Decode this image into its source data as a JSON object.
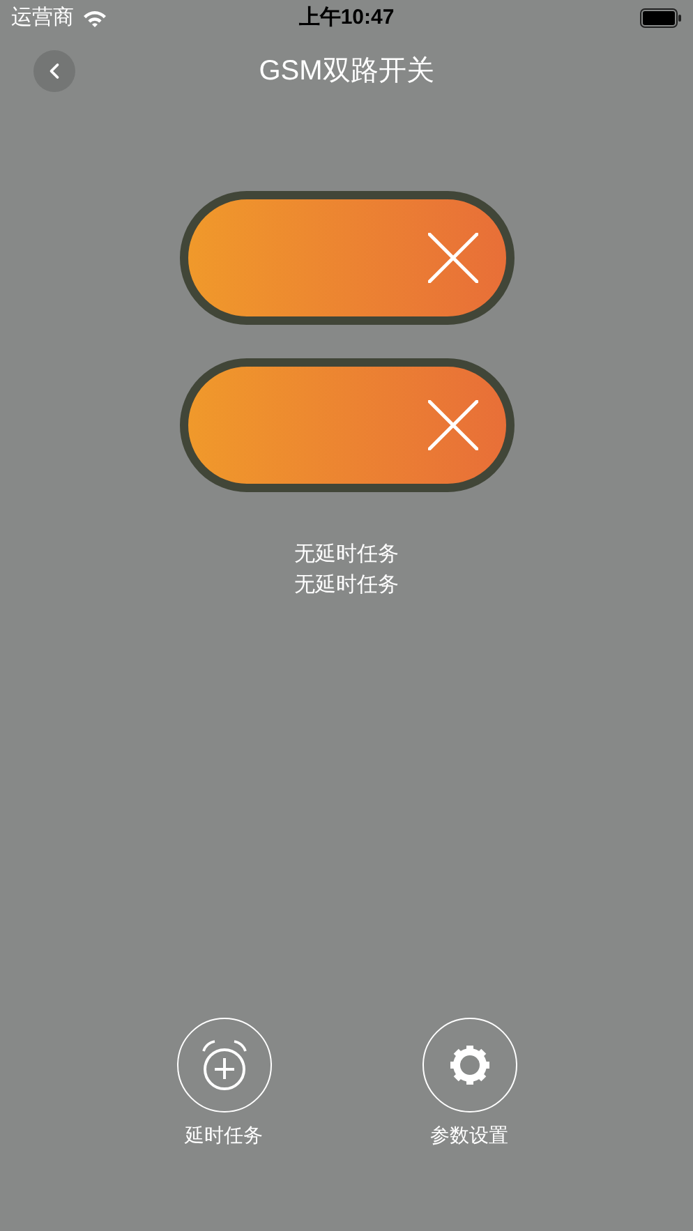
{
  "status_bar": {
    "carrier": "运营商",
    "time": "上午10:47"
  },
  "nav": {
    "title": "GSM双路开关"
  },
  "switches": [
    {
      "on": false
    },
    {
      "on": false
    }
  ],
  "task_lines": [
    "无延时任务",
    "无延时任务"
  ],
  "actions": [
    {
      "kind": "timer",
      "label": "延时任务"
    },
    {
      "kind": "settings",
      "label": "参数设置"
    }
  ]
}
